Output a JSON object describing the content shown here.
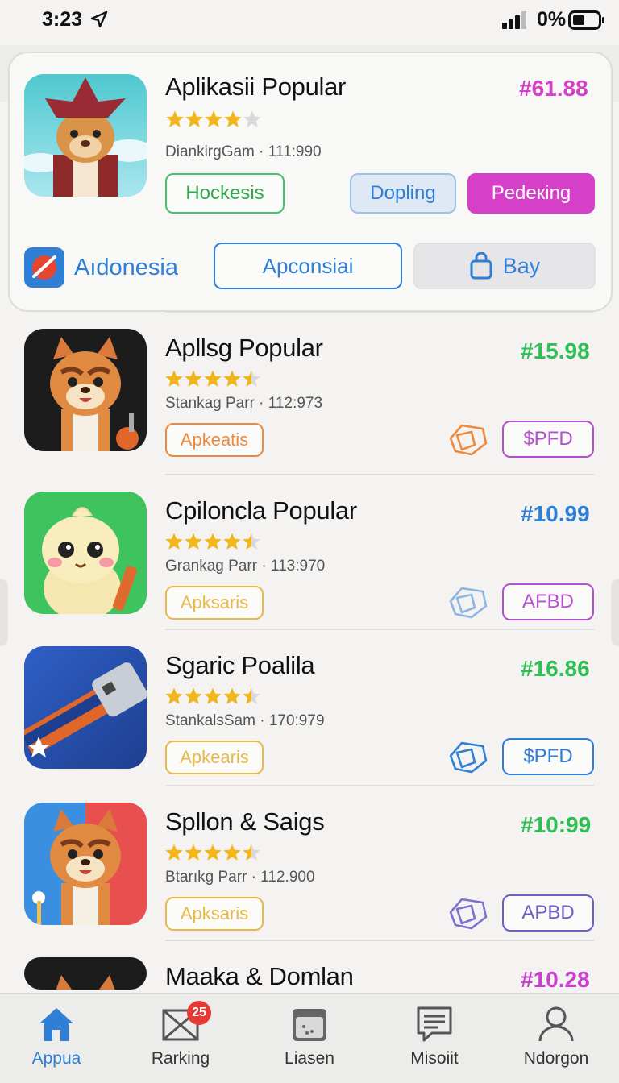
{
  "status_bar": {
    "time": "3:23",
    "battery": "0%"
  },
  "featured": {
    "title": "Aplikasii Popular",
    "price": "#61.88",
    "rating": 4,
    "meta": "DiankirgGam · 111:990",
    "buttons": {
      "hockesis": "Hockesis",
      "dopling": "Dopling",
      "pedering": "Pedeкing"
    },
    "brand": "Aıdonesia",
    "apconsiai": "Apconsiai",
    "bay": "Bay",
    "colors": {
      "price": "#d640c9",
      "pink": "#d93ec8",
      "green": "#2fbf54",
      "blue": "#2f7fd6"
    }
  },
  "apps": [
    {
      "title": "Apllsg Popular",
      "price": "#15.98",
      "price_color": "#2fbf54",
      "rating": 4.5,
      "meta": "Stankag Parr · 112:973",
      "tag": "Apkeatis",
      "tag_color": "#ef8a3c",
      "action": "$PFD",
      "action_color": "#b54fd1",
      "ghost_color": "#ef8a3c",
      "icon": "tiger-dark-icon"
    },
    {
      "title": "Cpiloncla Popular",
      "price": "#10.99",
      "price_color": "#2f7fd6",
      "rating": 4.5,
      "meta": "Grankag Parr · 113:970",
      "tag": "Apksaris",
      "tag_color": "#e8b94a",
      "action": "AFBD",
      "action_color": "#b54fd1",
      "ghost_color": "#8eb4e4",
      "icon": "hamster-green-icon"
    },
    {
      "title": "Sgaric Poalila",
      "price": "#16.86",
      "price_color": "#2fbf54",
      "rating": 4.5,
      "meta": "StankalsSam · 170:979",
      "tag": "Apkearis",
      "tag_color": "#e8b94a",
      "action": "$PFD",
      "action_color": "#2f7fd6",
      "ghost_color": "#2f7fd6",
      "icon": "usb-drive-icon"
    },
    {
      "title": "Spllon & Saigs",
      "price": "#10:99",
      "price_color": "#2fbf54",
      "rating": 4.5,
      "meta": "Btarıkg Parr · 112.900",
      "tag": "Apksaris",
      "tag_color": "#e8b94a",
      "action": "APBD",
      "action_color": "#6c5fc7",
      "ghost_color": "#7f6fcf",
      "icon": "tiger-split-icon"
    },
    {
      "title": "Maaka & Domlan",
      "price": "#10.28",
      "price_color": "#c93fcf",
      "icon": "tiger-partial-icon"
    }
  ],
  "nav": [
    {
      "label": "Appua",
      "icon": "home-icon",
      "active": true
    },
    {
      "label": "Rarking",
      "icon": "ranking-icon",
      "badge": "25"
    },
    {
      "label": "Liasen",
      "icon": "library-icon"
    },
    {
      "label": "Misoiit",
      "icon": "message-icon"
    },
    {
      "label": "Ndorgon",
      "icon": "profile-icon"
    }
  ]
}
